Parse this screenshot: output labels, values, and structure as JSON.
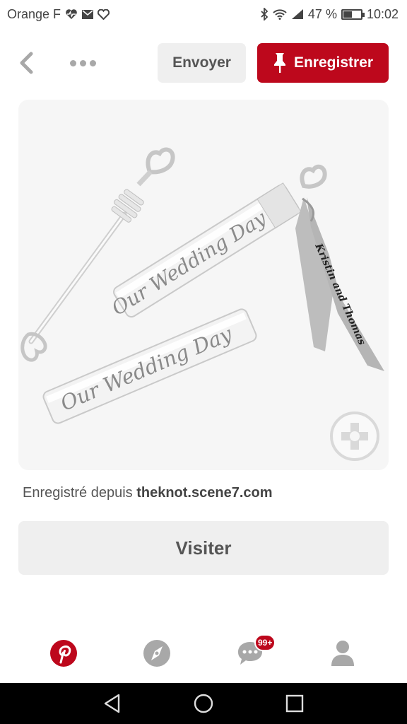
{
  "status_bar": {
    "carrier": "Orange F",
    "battery_text": "47 %",
    "battery_level": 0.47,
    "time": "10:02",
    "icons": [
      "heart-pulse-icon",
      "mail-icon",
      "heart-outline-icon",
      "bluetooth-icon",
      "wifi-icon",
      "signal-icon",
      "battery-icon"
    ]
  },
  "header": {
    "send_label": "Envoyer",
    "save_label": "Enregistrer",
    "icons": [
      "back-chevron-icon",
      "more-dots-icon",
      "pushpin-icon"
    ]
  },
  "pin": {
    "image_texts": {
      "tube_top": "Our Wedding Day",
      "tube_bottom": "Our Wedding Day",
      "ribbon": "Kristin and Thomas"
    },
    "lens_icon": "visual-search-icon"
  },
  "source": {
    "prefix": "Enregistré depuis",
    "domain": "theknot.scene7.com"
  },
  "visit_label": "Visiter",
  "tabs": {
    "items": [
      "pinterest-home-icon",
      "explore-compass-icon",
      "messages-icon",
      "profile-icon"
    ],
    "messages_badge": "99+"
  },
  "colors": {
    "brand_red": "#bd081c",
    "button_gray": "#efefef"
  },
  "android_nav": [
    "back-triangle-icon",
    "home-circle-icon",
    "recents-square-icon"
  ]
}
